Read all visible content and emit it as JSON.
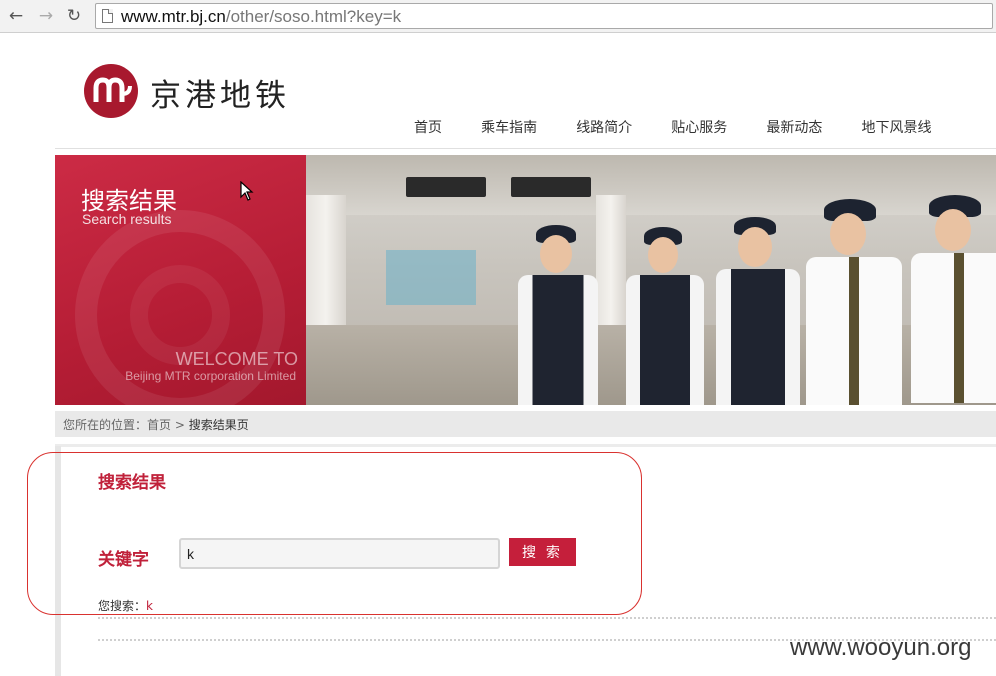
{
  "browser": {
    "url_host": "www.mtr.bj.cn",
    "url_path": "/other/soso.html?key=k"
  },
  "header": {
    "logo_text": "京港地铁",
    "nav": [
      "首页",
      "乘车指南",
      "线路简介",
      "贴心服务",
      "最新动态",
      "地下风景线"
    ]
  },
  "banner": {
    "title": "搜索结果",
    "subtitle": "Search results",
    "welcome": "WELCOME TO",
    "corp": "Beijing MTR corporation Limited"
  },
  "breadcrumb": {
    "prefix": "您所在的位置：",
    "home": "首页",
    "sep": " > ",
    "current": "搜索结果页"
  },
  "search": {
    "section_title": "搜索结果",
    "keyword_label": "关键字",
    "keyword_value": "k",
    "button_label": "搜 索",
    "result_prefix": "您搜索：",
    "result_keyword": "k"
  },
  "watermark": "www.wooyun.org",
  "colors": {
    "brand_red": "#c0213a",
    "annotation": "#d9322f"
  }
}
